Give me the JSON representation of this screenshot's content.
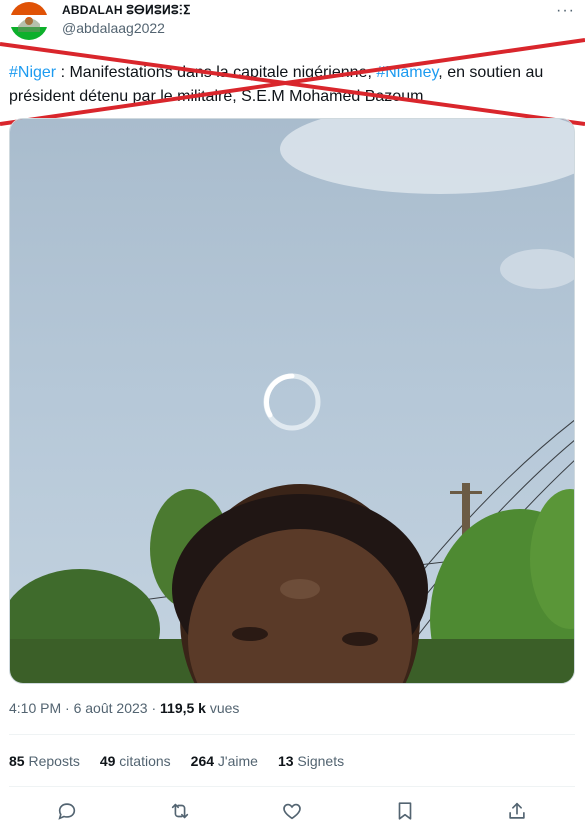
{
  "author": {
    "display_name": "ABDALAH ⵓⴱⵍⵓⵍⵓⵗⵉ",
    "handle": "@abdalaag2022"
  },
  "more_label": "···",
  "tweet": {
    "hashtag_1": "#Niger",
    "text_1": " : Manifestations dans la capitale nigérienne, ",
    "hashtag_2": "#Niamey",
    "text_2": ", en soutien au président détenu par le militaire, S.E.M Mohamed Bazoum"
  },
  "meta": {
    "time": "4:10 PM",
    "separator": " · ",
    "date": "6 août 2023",
    "separator2": " · ",
    "views_count": "119,5 k",
    "views_label": " vues"
  },
  "stats": {
    "reposts_count": "85",
    "reposts_label": "Reposts",
    "quotes_count": "49",
    "quotes_label": "citations",
    "likes_count": "264",
    "likes_label": "J'aime",
    "bookmarks_count": "13",
    "bookmarks_label": "Signets"
  },
  "icons": {
    "reply": "comment-icon",
    "repost": "repost-icon",
    "like": "heart-icon",
    "bookmark": "bookmark-icon",
    "share": "share-icon"
  },
  "colors": {
    "accent": "#1d9bf0",
    "cross": "#d9262c",
    "muted": "#536471"
  }
}
